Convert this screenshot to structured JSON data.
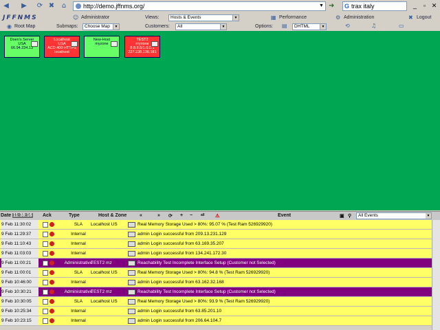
{
  "browser": {
    "url": "http://demo.jffnms.org/",
    "search_value": "trax italy",
    "search_engine_glyph": "G"
  },
  "app": {
    "logo": "JFFNMS",
    "user": "Administrator",
    "views_label": "Views:",
    "views_value": "Hosts & Events",
    "performance": "Performance",
    "administration": "Administration",
    "logout": "Logout",
    "root_map": "Root Map",
    "submaps_label": "Submaps:",
    "submaps_value": "Choose Map",
    "customers_label": "Customers:",
    "customers_value": "All",
    "options_label": "Options:",
    "options_value": "DHTML"
  },
  "map": {
    "color": "#00a651",
    "hosts": [
      {
        "lines": [
          "Doen's Server",
          "USA",
          "",
          "66.94.234.13"
        ],
        "status": "up"
      },
      {
        "lines": [
          "Localhost",
          "USA",
          "ACD 400 HTTPS",
          "localhost"
        ],
        "status": "down"
      },
      {
        "lines": [
          "New-Host",
          "myzone",
          "",
          ""
        ],
        "status": "up"
      },
      {
        "lines": [
          "TEST2",
          "myzone",
          "8.8.8.8/1.0.0.1",
          "237.238.136.181"
        ],
        "status": "down"
      }
    ]
  },
  "events": {
    "headers": {
      "date": "Date",
      "time_badge": "11:38:16",
      "ack": "Ack",
      "type": "Type",
      "host_zone": "Host & Zone",
      "event": "Event",
      "filter": "All Events",
      "all": "all"
    },
    "rows": [
      {
        "date": "9 Feb 11:30:02",
        "type": "SLA",
        "host": "Localhost US",
        "event": "Real Memory Storage Used > 80%: 95.07 % (Test Ram 526929920)",
        "color": "yellow"
      },
      {
        "date": "9 Feb 11:29:37",
        "type": "Internal",
        "host": "",
        "event": "admin Login successful from 209.13.231.129",
        "color": "yellow"
      },
      {
        "date": "9 Feb 11:10:43",
        "type": "Internal",
        "host": "",
        "event": "admin Login successful from 63.169.35.207",
        "color": "yellow"
      },
      {
        "date": "9 Feb 11:03:03",
        "type": "Internal",
        "host": "",
        "event": "admin Login successful from 134.241.172.30",
        "color": "yellow"
      },
      {
        "date": "9 Feb 11:00:21",
        "type": "Administrative",
        "host": "TEST2 mz",
        "event": "Reachability Test Incomplete Interface Setup (Customer not Selected)",
        "color": "purple"
      },
      {
        "date": "9 Feb 11:00:01",
        "type": "SLA",
        "host": "Localhost US",
        "event": "Real Memory Storage Used > 80%: 94.8 % (Test Ram 526929920)",
        "color": "yellow"
      },
      {
        "date": "9 Feb 10:46:00",
        "type": "Internal",
        "host": "",
        "event": "admin Login successful from 63.162.32.168",
        "color": "yellow"
      },
      {
        "date": "9 Feb 10:30:21",
        "type": "Administrative",
        "host": "TEST2 mz",
        "event": "Reachability Test Incomplete Interface Setup (Customer not Selected)",
        "color": "purple"
      },
      {
        "date": "9 Feb 10:30:05",
        "type": "SLA",
        "host": "Localhost US",
        "event": "Real Memory Storage Used > 80%: 93.9 % (Test Ram 526929920)",
        "color": "yellow"
      },
      {
        "date": "9 Feb 10:25:34",
        "type": "Internal",
        "host": "",
        "event": "admin Login successful from 63.85.201.10",
        "color": "yellow"
      },
      {
        "date": "9 Feb 10:23:15",
        "type": "Internal",
        "host": "",
        "event": "admin Login successful from 206.64.104.7",
        "color": "yellow"
      }
    ]
  }
}
